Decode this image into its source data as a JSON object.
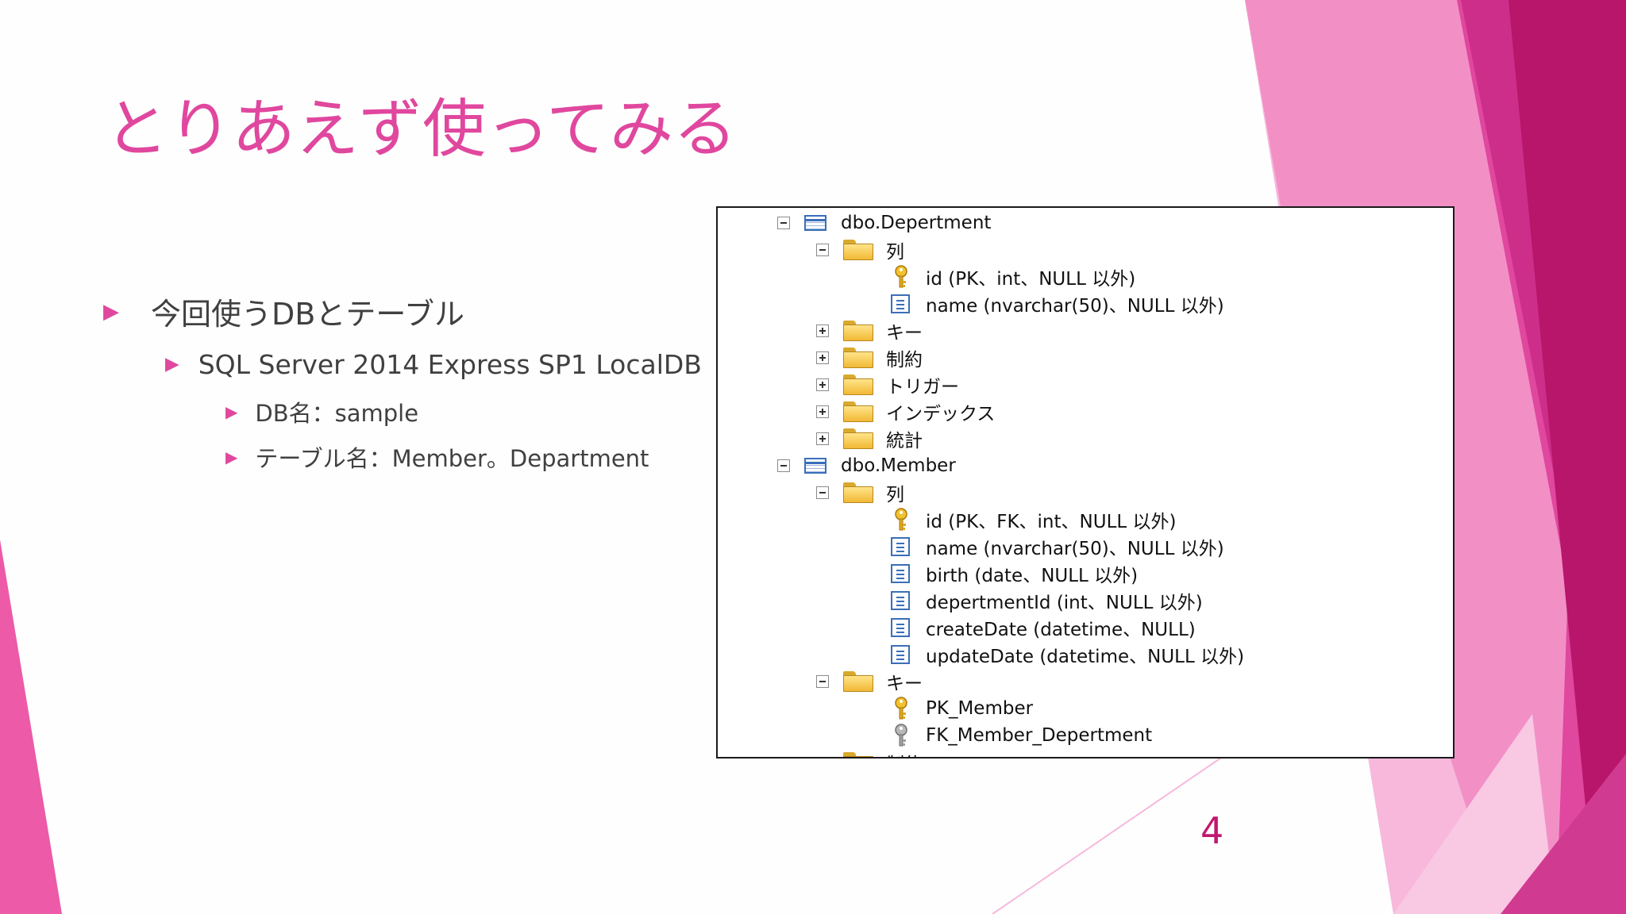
{
  "slide": {
    "title": "とりあえず使ってみる",
    "page_number": "4"
  },
  "bullets": {
    "level1": "今回使うDBとテーブル",
    "level2": "SQL Server 2014 Express SP1 LocalDB",
    "level3_db": "DB名：sample",
    "level3_tables": "テーブル名：Member。Department"
  },
  "tree": {
    "nodes": [
      "dbo.Depertment",
      "列",
      "id (PK、int、NULL 以外)",
      "name (nvarchar(50)、NULL 以外)",
      "キー",
      "制約",
      "トリガー",
      "インデックス",
      "統計",
      "dbo.Member",
      "列",
      "id (PK、FK、int、NULL 以外)",
      "name (nvarchar(50)、NULL 以外)",
      "birth (date、NULL 以外)",
      "depertmentId (int、NULL 以外)",
      "createDate (datetime、NULL)",
      "updateDate (datetime、NULL 以外)",
      "キー",
      "PK_Member",
      "FK_Member_Depertment",
      "制約"
    ]
  },
  "colors": {
    "accent": "#e0479e",
    "magenta_dark": "#c2186f",
    "pink_light": "#f5a0cf"
  }
}
